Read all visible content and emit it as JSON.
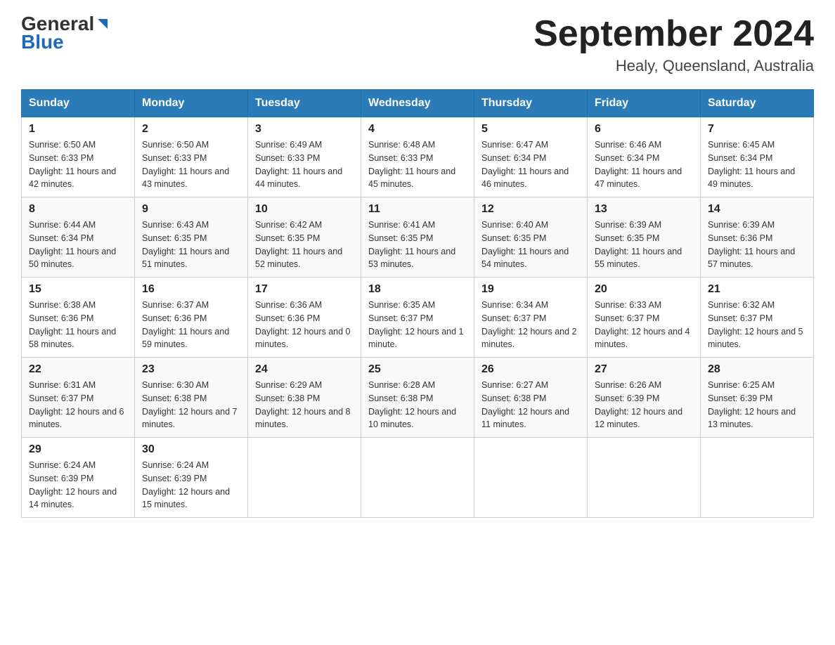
{
  "header": {
    "logo_general": "General",
    "logo_blue": "Blue",
    "title": "September 2024",
    "subtitle": "Healy, Queensland, Australia"
  },
  "days_of_week": [
    "Sunday",
    "Monday",
    "Tuesday",
    "Wednesday",
    "Thursday",
    "Friday",
    "Saturday"
  ],
  "weeks": [
    [
      {
        "day": "1",
        "sunrise": "6:50 AM",
        "sunset": "6:33 PM",
        "daylight": "11 hours and 42 minutes."
      },
      {
        "day": "2",
        "sunrise": "6:50 AM",
        "sunset": "6:33 PM",
        "daylight": "11 hours and 43 minutes."
      },
      {
        "day": "3",
        "sunrise": "6:49 AM",
        "sunset": "6:33 PM",
        "daylight": "11 hours and 44 minutes."
      },
      {
        "day": "4",
        "sunrise": "6:48 AM",
        "sunset": "6:33 PM",
        "daylight": "11 hours and 45 minutes."
      },
      {
        "day": "5",
        "sunrise": "6:47 AM",
        "sunset": "6:34 PM",
        "daylight": "11 hours and 46 minutes."
      },
      {
        "day": "6",
        "sunrise": "6:46 AM",
        "sunset": "6:34 PM",
        "daylight": "11 hours and 47 minutes."
      },
      {
        "day": "7",
        "sunrise": "6:45 AM",
        "sunset": "6:34 PM",
        "daylight": "11 hours and 49 minutes."
      }
    ],
    [
      {
        "day": "8",
        "sunrise": "6:44 AM",
        "sunset": "6:34 PM",
        "daylight": "11 hours and 50 minutes."
      },
      {
        "day": "9",
        "sunrise": "6:43 AM",
        "sunset": "6:35 PM",
        "daylight": "11 hours and 51 minutes."
      },
      {
        "day": "10",
        "sunrise": "6:42 AM",
        "sunset": "6:35 PM",
        "daylight": "11 hours and 52 minutes."
      },
      {
        "day": "11",
        "sunrise": "6:41 AM",
        "sunset": "6:35 PM",
        "daylight": "11 hours and 53 minutes."
      },
      {
        "day": "12",
        "sunrise": "6:40 AM",
        "sunset": "6:35 PM",
        "daylight": "11 hours and 54 minutes."
      },
      {
        "day": "13",
        "sunrise": "6:39 AM",
        "sunset": "6:35 PM",
        "daylight": "11 hours and 55 minutes."
      },
      {
        "day": "14",
        "sunrise": "6:39 AM",
        "sunset": "6:36 PM",
        "daylight": "11 hours and 57 minutes."
      }
    ],
    [
      {
        "day": "15",
        "sunrise": "6:38 AM",
        "sunset": "6:36 PM",
        "daylight": "11 hours and 58 minutes."
      },
      {
        "day": "16",
        "sunrise": "6:37 AM",
        "sunset": "6:36 PM",
        "daylight": "11 hours and 59 minutes."
      },
      {
        "day": "17",
        "sunrise": "6:36 AM",
        "sunset": "6:36 PM",
        "daylight": "12 hours and 0 minutes."
      },
      {
        "day": "18",
        "sunrise": "6:35 AM",
        "sunset": "6:37 PM",
        "daylight": "12 hours and 1 minute."
      },
      {
        "day": "19",
        "sunrise": "6:34 AM",
        "sunset": "6:37 PM",
        "daylight": "12 hours and 2 minutes."
      },
      {
        "day": "20",
        "sunrise": "6:33 AM",
        "sunset": "6:37 PM",
        "daylight": "12 hours and 4 minutes."
      },
      {
        "day": "21",
        "sunrise": "6:32 AM",
        "sunset": "6:37 PM",
        "daylight": "12 hours and 5 minutes."
      }
    ],
    [
      {
        "day": "22",
        "sunrise": "6:31 AM",
        "sunset": "6:37 PM",
        "daylight": "12 hours and 6 minutes."
      },
      {
        "day": "23",
        "sunrise": "6:30 AM",
        "sunset": "6:38 PM",
        "daylight": "12 hours and 7 minutes."
      },
      {
        "day": "24",
        "sunrise": "6:29 AM",
        "sunset": "6:38 PM",
        "daylight": "12 hours and 8 minutes."
      },
      {
        "day": "25",
        "sunrise": "6:28 AM",
        "sunset": "6:38 PM",
        "daylight": "12 hours and 10 minutes."
      },
      {
        "day": "26",
        "sunrise": "6:27 AM",
        "sunset": "6:38 PM",
        "daylight": "12 hours and 11 minutes."
      },
      {
        "day": "27",
        "sunrise": "6:26 AM",
        "sunset": "6:39 PM",
        "daylight": "12 hours and 12 minutes."
      },
      {
        "day": "28",
        "sunrise": "6:25 AM",
        "sunset": "6:39 PM",
        "daylight": "12 hours and 13 minutes."
      }
    ],
    [
      {
        "day": "29",
        "sunrise": "6:24 AM",
        "sunset": "6:39 PM",
        "daylight": "12 hours and 14 minutes."
      },
      {
        "day": "30",
        "sunrise": "6:24 AM",
        "sunset": "6:39 PM",
        "daylight": "12 hours and 15 minutes."
      },
      null,
      null,
      null,
      null,
      null
    ]
  ],
  "labels": {
    "sunrise": "Sunrise:",
    "sunset": "Sunset:",
    "daylight": "Daylight:"
  }
}
